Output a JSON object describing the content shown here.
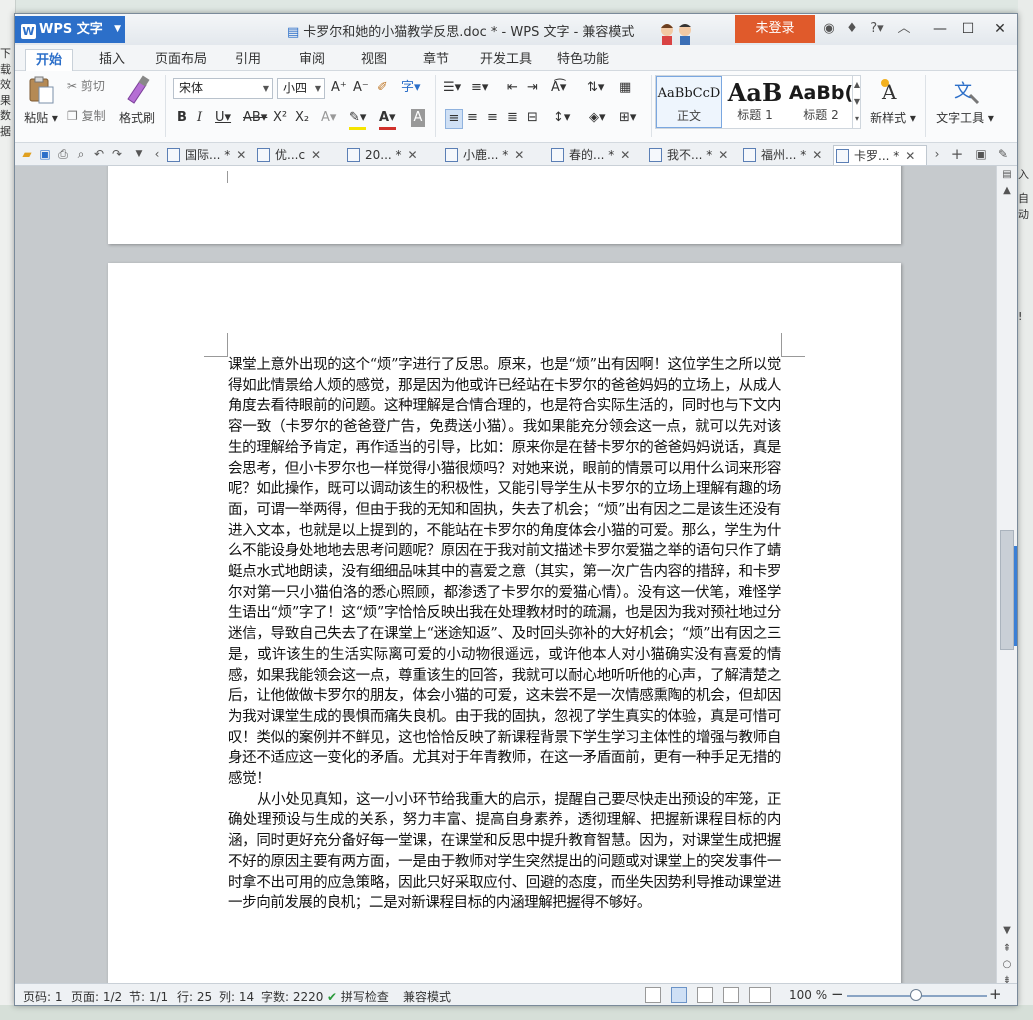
{
  "desktop": {
    "left_fragments": [
      "下载",
      "效果",
      "数据"
    ],
    "right_fragments": [
      "入",
      "自动",
      "!"
    ]
  },
  "app": {
    "name": "WPS 文字",
    "document_title": "卡罗尔和她的小猫教学反思.doc * - WPS 文字 - 兼容模式",
    "login_label": "未登录"
  },
  "menu": {
    "tabs": [
      "开始",
      "插入",
      "页面布局",
      "引用",
      "审阅",
      "视图",
      "章节",
      "开发工具",
      "特色功能"
    ],
    "active_tab": "开始"
  },
  "ribbon": {
    "paste": "粘贴",
    "cut": "剪切",
    "copy": "复制",
    "format_painter": "格式刷",
    "font_name": "宋体",
    "font_size": "小四",
    "styles": [
      {
        "preview": "AaBbCcD",
        "name": "正文"
      },
      {
        "preview": "AaB",
        "name": "标题 1"
      },
      {
        "preview": "AaBb(",
        "name": "标题 2"
      }
    ],
    "new_style": "新样式",
    "text_tools": "文字工具"
  },
  "doc_tabs": [
    {
      "label": "国际... *",
      "active": false
    },
    {
      "label": "优...c",
      "active": false
    },
    {
      "label": "20... *",
      "active": false
    },
    {
      "label": "小鹿... *",
      "active": false
    },
    {
      "label": "春的... *",
      "active": false
    },
    {
      "label": "我不... *",
      "active": false
    },
    {
      "label": "福州... *",
      "active": false
    },
    {
      "label": "卡罗... *",
      "active": true
    }
  ],
  "document": {
    "paragraph1": "课堂上意外出现的这个“烦”字进行了反思。原来，也是“烦”出有因啊！这位学生之所以觉得如此情景给人烦的感觉，那是因为他或许已经站在卡罗尔的爸爸妈妈的立场上，从成人角度去看待眼前的问题。这种理解是合情合理的，也是符合实际生活的，同时也与下文内容一致（卡罗尔的爸爸登广告，免费送小猫）。我如果能充分领会这一点，就可以先对该生的理解给予肯定，再作适当的引导，比如：原来你是在替卡罗尔的爸爸妈妈说话，真是会思考，但小卡罗尔也一样觉得小猫很烦吗？对她来说，眼前的情景可以用什么词来形容呢？如此操作，既可以调动该生的积极性，又能引导学生从卡罗尔的立场上理解有趣的场面，可谓一举两得，但由于我的无知和固执，失去了机会；“烦”出有因之二是该生还没有进入文本，也就是以上提到的，不能站在卡罗尔的角度体会小猫的可爱。那么，学生为什么不能设身处地地去思考问题呢？原因在于我对前文描述卡罗尔爱猫之举的语句只作了蜻蜓点水式地朗读，没有细细品味其中的喜爱之意（其实，第一次广告内容的措辞，和卡罗尔对第一只小猫伯洛的悉心照顾，都渗透了卡罗尔的爱猫心情）。没有这一伏笔，难怪学生语出“烦”字了！这“烦”字恰恰反映出我在处理教材时的疏漏，也是因为我对预社地过分迷信，导致自己失去了在课堂上“迷途知返”、及时回头弥补的大好机会；“烦”出有因之三是，或许该生的生活实际离可爱的小动物很遥远，或许他本人对小猫确实没有喜爱的情感，如果我能领会这一点，尊重该生的回答，我就可以耐心地听听他的心声，了解清楚之后，让他做做卡罗尔的朋友，体会小猫的可爱，这未尝不是一次情感熏陶的机会，但却因为我对课堂生成的畏惧而痛失良机。由于我的固执，忽视了学生真实的体验，真是可惜可叹！类似的案例并不鲜见，这也恰恰反映了新课程背景下学生学习主体性的增强与教师自身还不适应这一变化的矛盾。尤其对于年青教师，在这一矛盾面前，更有一种手足无措的感觉！",
    "paragraph2": "从小处见真知，这一小小环节给我重大的启示，提醒自己要尽快走出预设的牢笼，正确处理预设与生成的关系，努力丰富、提高自身素养，透彻理解、把握新课程目标的内涵，同时更好充分备好每一堂课，在课堂和反思中提升教育智慧。因为，对课堂生成把握不好的原因主要有两方面，一是由于教师对学生突然提出的问题或对课堂上的突发事件一时拿不出可用的应急策略，因此只好采取应付、回避的态度，而坐失因势利导推动课堂进一步向前发展的良机；二是对新课程目标的内涵理解把握得不够好。"
  },
  "status": {
    "page_num": "页码: 1",
    "page": "页面: 1/2",
    "section": "节: 1/1",
    "row": "行: 25",
    "col": "列: 14",
    "word_count": "字数: 2220",
    "spell_check": "拼写检查",
    "mode": "兼容模式",
    "zoom": "100 %"
  },
  "colors": {
    "accent": "#2c6fc9",
    "login": "#e05a2b"
  }
}
